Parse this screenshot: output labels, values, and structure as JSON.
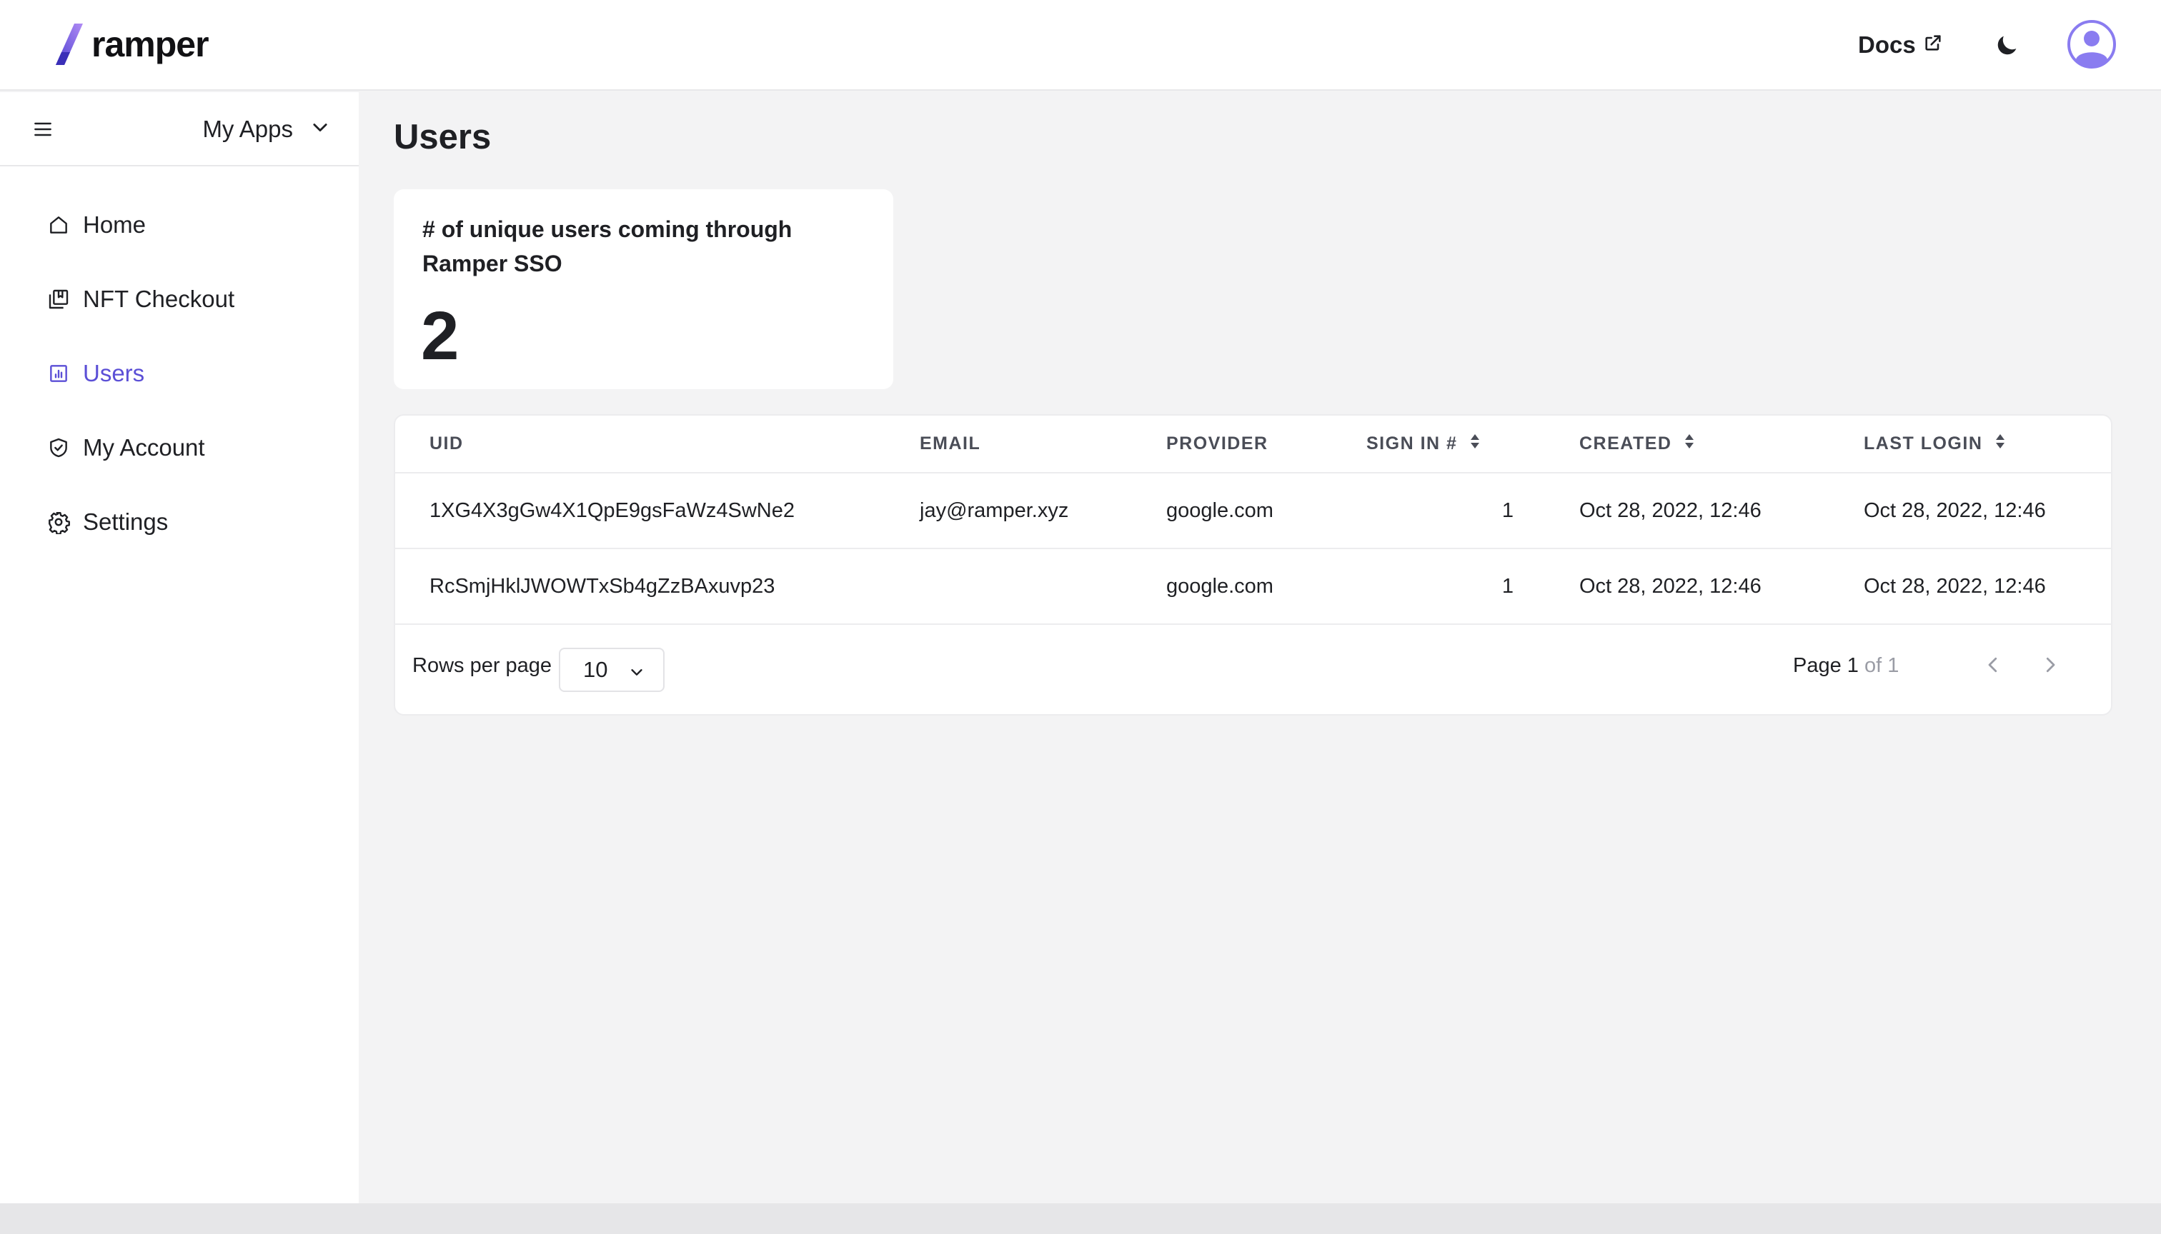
{
  "header": {
    "logo_text": "ramper",
    "docs_label": "Docs",
    "icons": {
      "logo": "ramper-logo-icon",
      "external_link": "external-link-icon",
      "theme_toggle": "moon-icon",
      "avatar": "user-avatar-icon"
    }
  },
  "sidebar": {
    "app_switcher_label": "My Apps",
    "items": [
      {
        "label": "Home",
        "icon": "home-icon",
        "active": false
      },
      {
        "label": "NFT Checkout",
        "icon": "nft-checkout-icon",
        "active": false
      },
      {
        "label": "Users",
        "icon": "chart-icon",
        "active": true
      },
      {
        "label": "My Account",
        "icon": "shield-check-icon",
        "active": false
      },
      {
        "label": "Settings",
        "icon": "gear-icon",
        "active": false
      }
    ]
  },
  "main": {
    "title": "Users",
    "stat_card": {
      "label": "# of unique users coming through Ramper SSO",
      "value": "2"
    },
    "table": {
      "columns": [
        "UID",
        "EMAIL",
        "PROVIDER",
        "SIGN IN #",
        "CREATED",
        "LAST LOGIN"
      ],
      "sortable": [
        false,
        false,
        false,
        true,
        true,
        true
      ],
      "rows": [
        [
          "1XG4X3gGw4X1QpE9gsFaWz4SwNe2",
          "jay@ramper.xyz",
          "google.com",
          "1",
          "Oct 28, 2022, 12:46",
          "Oct 28, 2022, 12:46"
        ],
        [
          "RcSmjHklJWOWTxSb4gZzBAxuvp23",
          "",
          "google.com",
          "1",
          "Oct 28, 2022, 12:46",
          "Oct 28, 2022, 12:46"
        ]
      ]
    },
    "pagination": {
      "rows_per_page_label": "Rows per page",
      "rows_per_page_value": "10",
      "page_word": "Page",
      "current_page": "1",
      "of_total": "of 1"
    }
  },
  "colors": {
    "accent": "#5b4fd6",
    "background": "#f3f3f4",
    "surface": "#ffffff",
    "text": "#1f2024",
    "avatar": "#8a7cf0"
  }
}
